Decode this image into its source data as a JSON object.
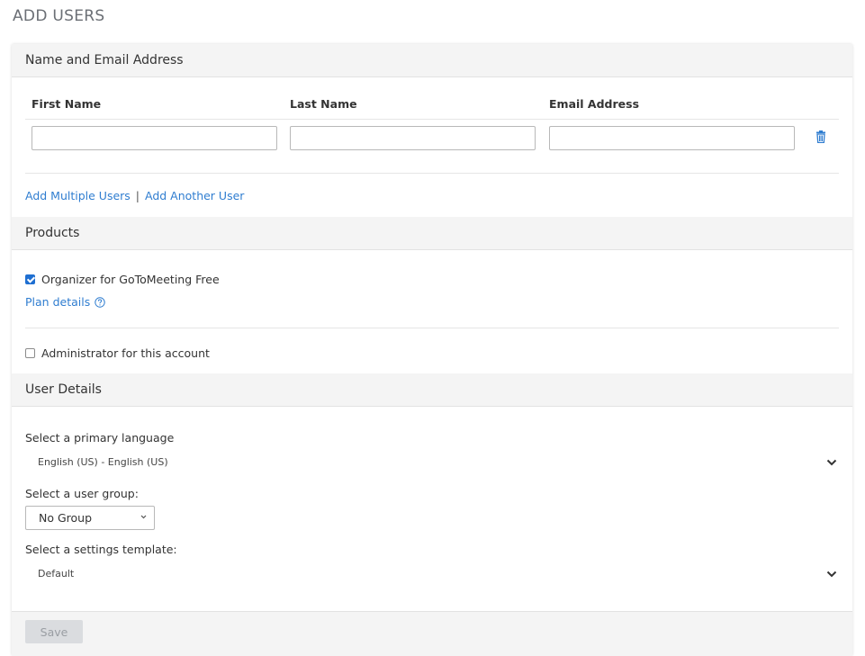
{
  "page": {
    "title": "ADD USERS"
  },
  "name_email": {
    "header": "Name and Email Address",
    "columns": {
      "first": "First Name",
      "last": "Last Name",
      "email": "Email Address"
    },
    "first_value": "",
    "last_value": "",
    "email_value": "",
    "add_multiple": "Add Multiple Users",
    "separator": "|",
    "add_another": "Add Another User"
  },
  "products": {
    "header": "Products",
    "organizer_label": "Organizer for GoToMeeting Free",
    "organizer_checked": true,
    "plan_details": "Plan details",
    "admin_label": "Administrator for this account",
    "admin_checked": false
  },
  "user_details": {
    "header": "User Details",
    "language_label": "Select a primary language",
    "language_value": "English (US) - English (US)",
    "group_label": "Select a user group:",
    "group_value": "No Group",
    "template_label": "Select a settings template:",
    "template_value": "Default"
  },
  "footer": {
    "save_label": "Save"
  },
  "colors": {
    "link": "#2f7dd0",
    "checkbox_accent": "#1f6fd1",
    "section_bg": "#f4f4f4"
  },
  "icons": {
    "delete": "trash-icon",
    "help": "help-circle-icon",
    "dropdown": "chevron-down-icon"
  }
}
